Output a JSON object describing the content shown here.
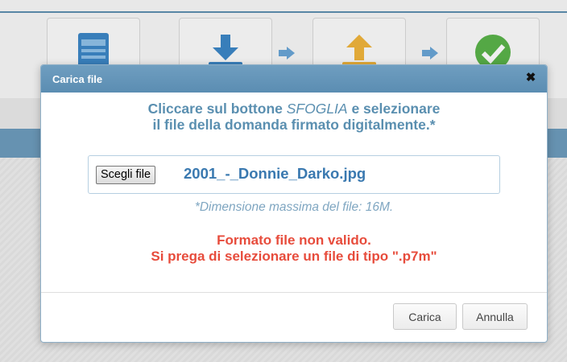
{
  "dialog": {
    "title": "Carica file",
    "close_glyph": "✖",
    "instruction": {
      "part1": "Cliccare sul bottone ",
      "part2": "SFOGLIA",
      "part3": " e selezionare",
      "line2": "il file della domanda firmato digitalmente.*"
    },
    "file_input": {
      "button_label": "Scegli file",
      "file_name": "2001_-_Donnie_Darko.jpg"
    },
    "hint": "*Dimensione massima del file: 16M.",
    "error": {
      "line1": "Formato file non valido.",
      "line2": "Si prega di selezionare un file di tipo \".p7m\""
    },
    "buttons": {
      "upload_label": "Carica",
      "cancel_label": "Annulla"
    }
  },
  "steps": [
    {
      "icon": "server-icon"
    },
    {
      "icon": "download-icon"
    },
    {
      "icon": "upload-icon"
    },
    {
      "icon": "checkmark-icon"
    }
  ],
  "colors": {
    "header": "#5b8db2",
    "instruction_text": "#5a8fb0",
    "error_text": "#e74c3c",
    "file_name": "#3a79b0"
  }
}
